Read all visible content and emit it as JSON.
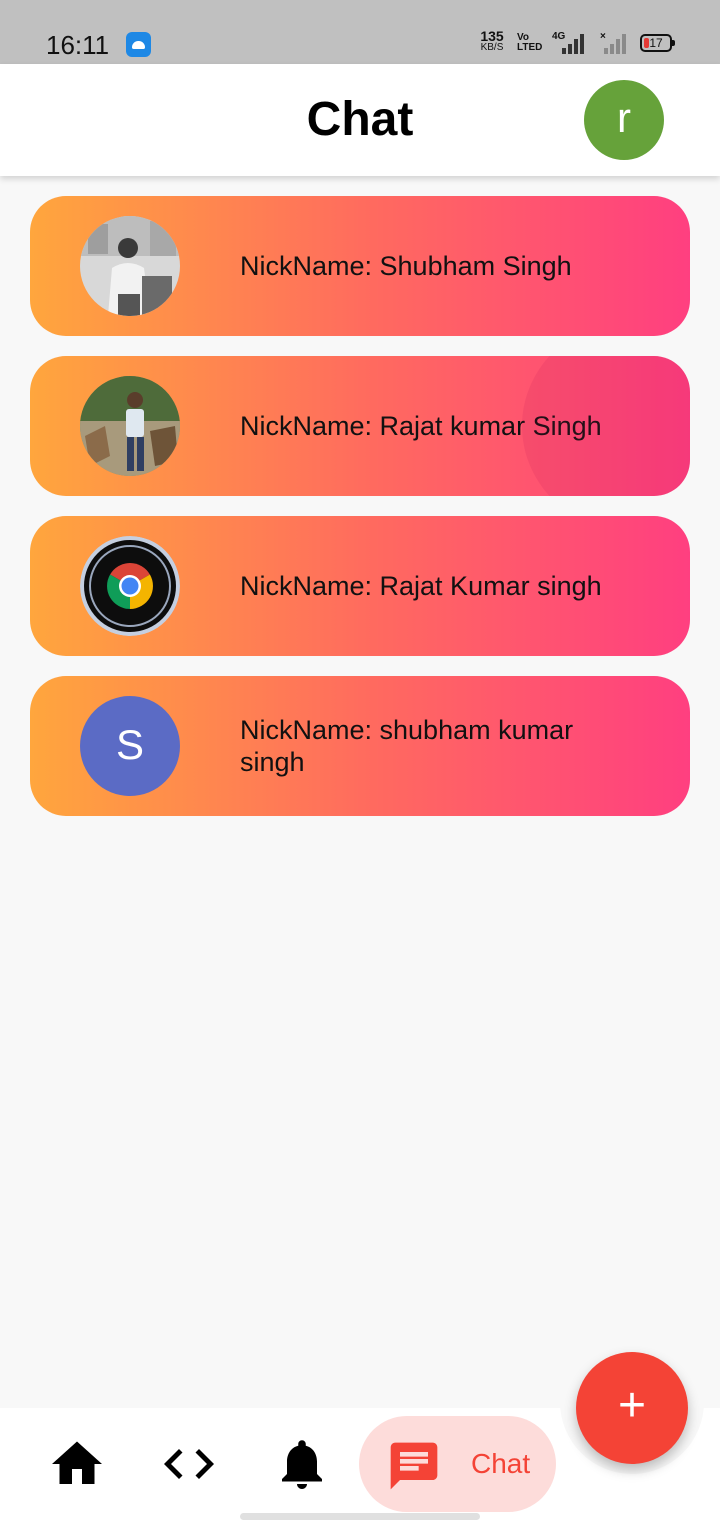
{
  "status_bar": {
    "time": "16:11",
    "net_speed_value": "135",
    "net_speed_unit": "KB/S",
    "volte_line1": "Vo",
    "volte_line2": "LTED",
    "network_type": "4G",
    "battery_level": "17"
  },
  "app_bar": {
    "title": "Chat",
    "profile_initial": "r",
    "profile_color": "#66a23a"
  },
  "chats": [
    {
      "nickname": "NickName: Shubham Singh",
      "avatar": "photo-grayscale"
    },
    {
      "nickname": "NickName: Rajat kumar Singh",
      "avatar": "photo-outdoor"
    },
    {
      "nickname": "NickName: Rajat Kumar singh",
      "avatar": "chrome-logo"
    },
    {
      "nickname": "NickName: shubham kumar singh",
      "avatar_letter": "S",
      "avatar_color": "#5b6bc5"
    }
  ],
  "gradient_colors": [
    "#ffa63d",
    "#ff6a5f",
    "#ff3f80"
  ],
  "bottom_nav": {
    "items": [
      {
        "icon": "home-icon"
      },
      {
        "icon": "code-icon"
      },
      {
        "icon": "bell-icon"
      },
      {
        "icon": "chat-bubble-icon",
        "label": "Chat",
        "selected": true
      }
    ],
    "accent": "#f44336"
  },
  "fab": {
    "icon": "plus-icon",
    "glyph": "+"
  }
}
